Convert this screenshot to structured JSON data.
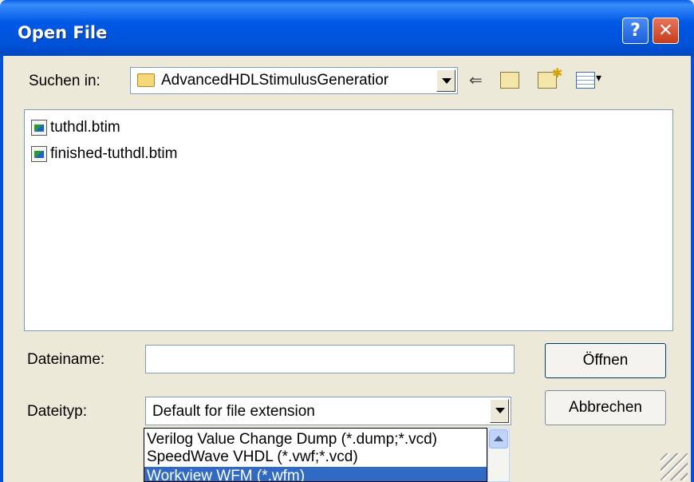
{
  "window": {
    "title": "Open File"
  },
  "title_buttons": {
    "help": "?",
    "close": "✕"
  },
  "look_in": {
    "label": "Suchen in:",
    "value": "AdvancedHDLStimulusGeneratior"
  },
  "toolbar": {
    "back_icon": "arrow-left-icon",
    "up_icon": "folder-up-icon",
    "new_folder_icon": "new-folder-icon",
    "views_icon": "view-menu-icon"
  },
  "files": [
    {
      "name": "tuthdl.btim"
    },
    {
      "name": "finished-tuthdl.btim"
    }
  ],
  "filename": {
    "label": "Dateiname:",
    "value": ""
  },
  "filetype": {
    "label": "Dateityp:",
    "value": "Default for file extension",
    "options": [
      "Verilog Value Change Dump (*.dump;*.vcd)",
      "SpeedWave VHDL (*.vwf;*.vcd)",
      "Workview WFM (*.wfm)"
    ],
    "selected_index": 2
  },
  "buttons": {
    "open": "Öffnen",
    "cancel": "Abbrechen"
  },
  "colors": {
    "title_bar": "#0058e6",
    "selection": "#316ac5",
    "dialog_bg": "#ece9d8"
  }
}
